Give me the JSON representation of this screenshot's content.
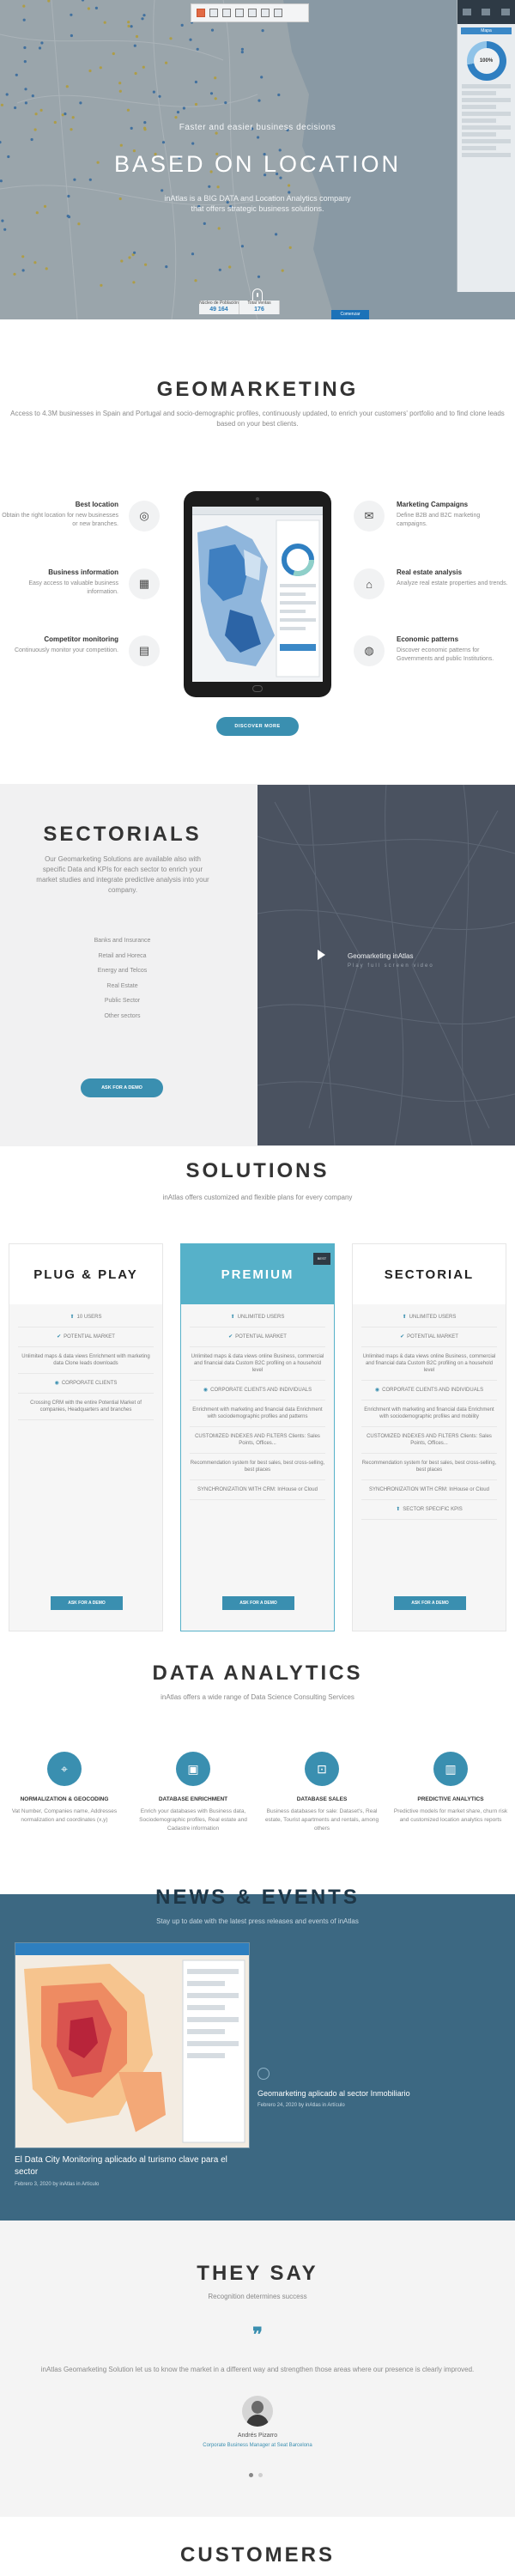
{
  "hero": {
    "subtitle": "Faster and easier business decisions",
    "title": "BASED ON LOCATION",
    "description": "inAtlas is a BIG DATA and Location Analytics company that offers strategic business solutions.",
    "stats": [
      {
        "label": "Núcleo de Población",
        "value": "49 164"
      },
      {
        "label": "Total Ventas",
        "value": "176"
      }
    ],
    "panel_tab": "Mapa",
    "panel_percent": "100%",
    "cta": "Comenzar"
  },
  "geomarketing": {
    "title": "GEOMARKETING",
    "intro": "Access to 4.3M businesses in Spain and Portugal and socio-demographic profiles, continuously updated, to enrich your customers' portfolio and to find clone leads based on your best clients.",
    "features_left": [
      {
        "title": "Best location",
        "text": "Obtain the right location for new businesses or new branches.",
        "icon": "target-icon",
        "glyph": "◎"
      },
      {
        "title": "Business information",
        "text": "Easy access to valuable business information.",
        "icon": "chart-icon",
        "glyph": "▦"
      },
      {
        "title": "Competitor monitoring",
        "text": "Continuously monitor your competition.",
        "icon": "monitor-icon",
        "glyph": "▤"
      }
    ],
    "features_right": [
      {
        "title": "Marketing Campaigns",
        "text": "Define B2B and B2C marketing campaigns.",
        "icon": "megaphone-icon",
        "glyph": "✉"
      },
      {
        "title": "Real estate analysis",
        "text": "Analyze real estate properties and trends.",
        "icon": "house-icon",
        "glyph": "⌂"
      },
      {
        "title": "Economic patterns",
        "text": "Discover economic patterns for Governments and public Institutions.",
        "icon": "globe-icon",
        "glyph": "◍"
      }
    ],
    "button": "DISCOVER MORE"
  },
  "sectorials": {
    "title": "SECTORIALS",
    "description": "Our Geomarketing Solutions are available also with specific Data and KPIs for each sector to enrich your market studies and integrate predictive analysis into your company.",
    "items": [
      "Banks and Insurance",
      "Retail and Horeca",
      "Energy and Telcos",
      "Real Estate",
      "Public Sector",
      "Other sectors"
    ],
    "button": "ASK FOR A DEMO",
    "video_label": "Geomarketing inAtlas",
    "video_tag": "Play full screen video"
  },
  "solutions": {
    "title": "SOLUTIONS",
    "subtitle": "inAtlas offers customized and flexible plans for every company",
    "plans": [
      {
        "name": "PLUG & PLAY",
        "features": [
          "10 USERS",
          "POTENTIAL MARKET",
          "Unlimited maps & data views Enrichment with marketing data Clone leads downloads",
          "CORPORATE CLIENTS",
          "Crossing CRM with the entire Potential Market of companies, Headquarters and branches"
        ],
        "button": "ASK FOR A DEMO"
      },
      {
        "name": "PREMIUM",
        "badge": "BEST",
        "features": [
          "UNLIMITED USERS",
          "POTENTIAL MARKET",
          "Unlimited maps & data views online Business, commercial and financial data Custom B2C profiling on a household level",
          "CORPORATE CLIENTS AND INDIVIDUALS",
          "Enrichment with marketing and financial data Enrichment with sociodemographic profiles and patterns",
          "CUSTOMIZED INDEXES AND FILTERS Clients: Sales Points, Offices...",
          "Recommendation system for best sales, best cross-selling, best places",
          "SYNCHRONIZATION WITH CRM: InHouse or Cloud"
        ],
        "button": "ASK FOR A DEMO"
      },
      {
        "name": "SECTORIAL",
        "features": [
          "UNLIMITED USERS",
          "POTENTIAL MARKET",
          "Unlimited maps & data views online Business, commercial and financial data Custom B2C profiling on a household level",
          "CORPORATE CLIENTS AND INDIVIDUALS",
          "Enrichment with marketing and financial data Enrichment with sociodemographic profiles and mobility",
          "CUSTOMIZED INDEXES AND FILTERS Clients: Sales Points, Offices...",
          "Recommendation system for best sales, best cross-selling, best places",
          "SYNCHRONIZATION WITH CRM: InHouse or Cloud",
          "SECTOR SPECIFIC KPIS"
        ],
        "button": "ASK FOR A DEMO"
      }
    ]
  },
  "analytics": {
    "title": "DATA ANALYTICS",
    "subtitle": "inAtlas offers a wide range of Data Science Consulting Services",
    "items": [
      {
        "title": "NORMALIZATION & GEOCODING",
        "text": "Vat Number, Companies name, Addresses normalization and coordinates (x,y)",
        "icon": "pin-icon",
        "color": "#3a8fb0",
        "glyph": "⌖"
      },
      {
        "title": "DATABASE ENRICHMENT",
        "text": "Enrich your databases with Business data, Sociodemographic profiles, Real estate and Cadastre information",
        "icon": "document-icon",
        "color": "#3a8fb0",
        "glyph": "▣"
      },
      {
        "title": "DATABASE SALES",
        "text": "Business databases for sale: Dataset's, Real estate, Tourist apartments and rentals, among others",
        "icon": "cart-icon",
        "color": "#3a8fb0",
        "glyph": "⊡"
      },
      {
        "title": "PREDICTIVE ANALYTICS",
        "text": "Predictive models for market share, churn risk and customized location analytics reports",
        "icon": "analytics-icon",
        "color": "#3a8fb0",
        "glyph": "▥"
      }
    ]
  },
  "news": {
    "title": "NEWS & EVENTS",
    "subtitle": "Stay up to date with the latest press releases and events of inAtlas",
    "main_title": "El Data City Monitoring aplicado al turismo clave para el sector",
    "main_meta": "Febrero 3, 2020 by inAtlas in Artículo",
    "side_title": "Geomarketing aplicado al sector Inmobiliario",
    "side_meta": "Febrero 24, 2020 by inAtlas in Artículo"
  },
  "testimonials": {
    "title": "THEY SAY",
    "subtitle": "Recognition determines success",
    "quote_mark": "❞",
    "quote": "inAtlas Geomarketing Solution let us to know the market in a different way and strengthen those areas where our presence is clearly improved.",
    "name": "Andrés Pizarro",
    "role": "Corporate Business Manager at Seat Barcelona"
  },
  "customers": {
    "title": "CUSTOMERS"
  }
}
